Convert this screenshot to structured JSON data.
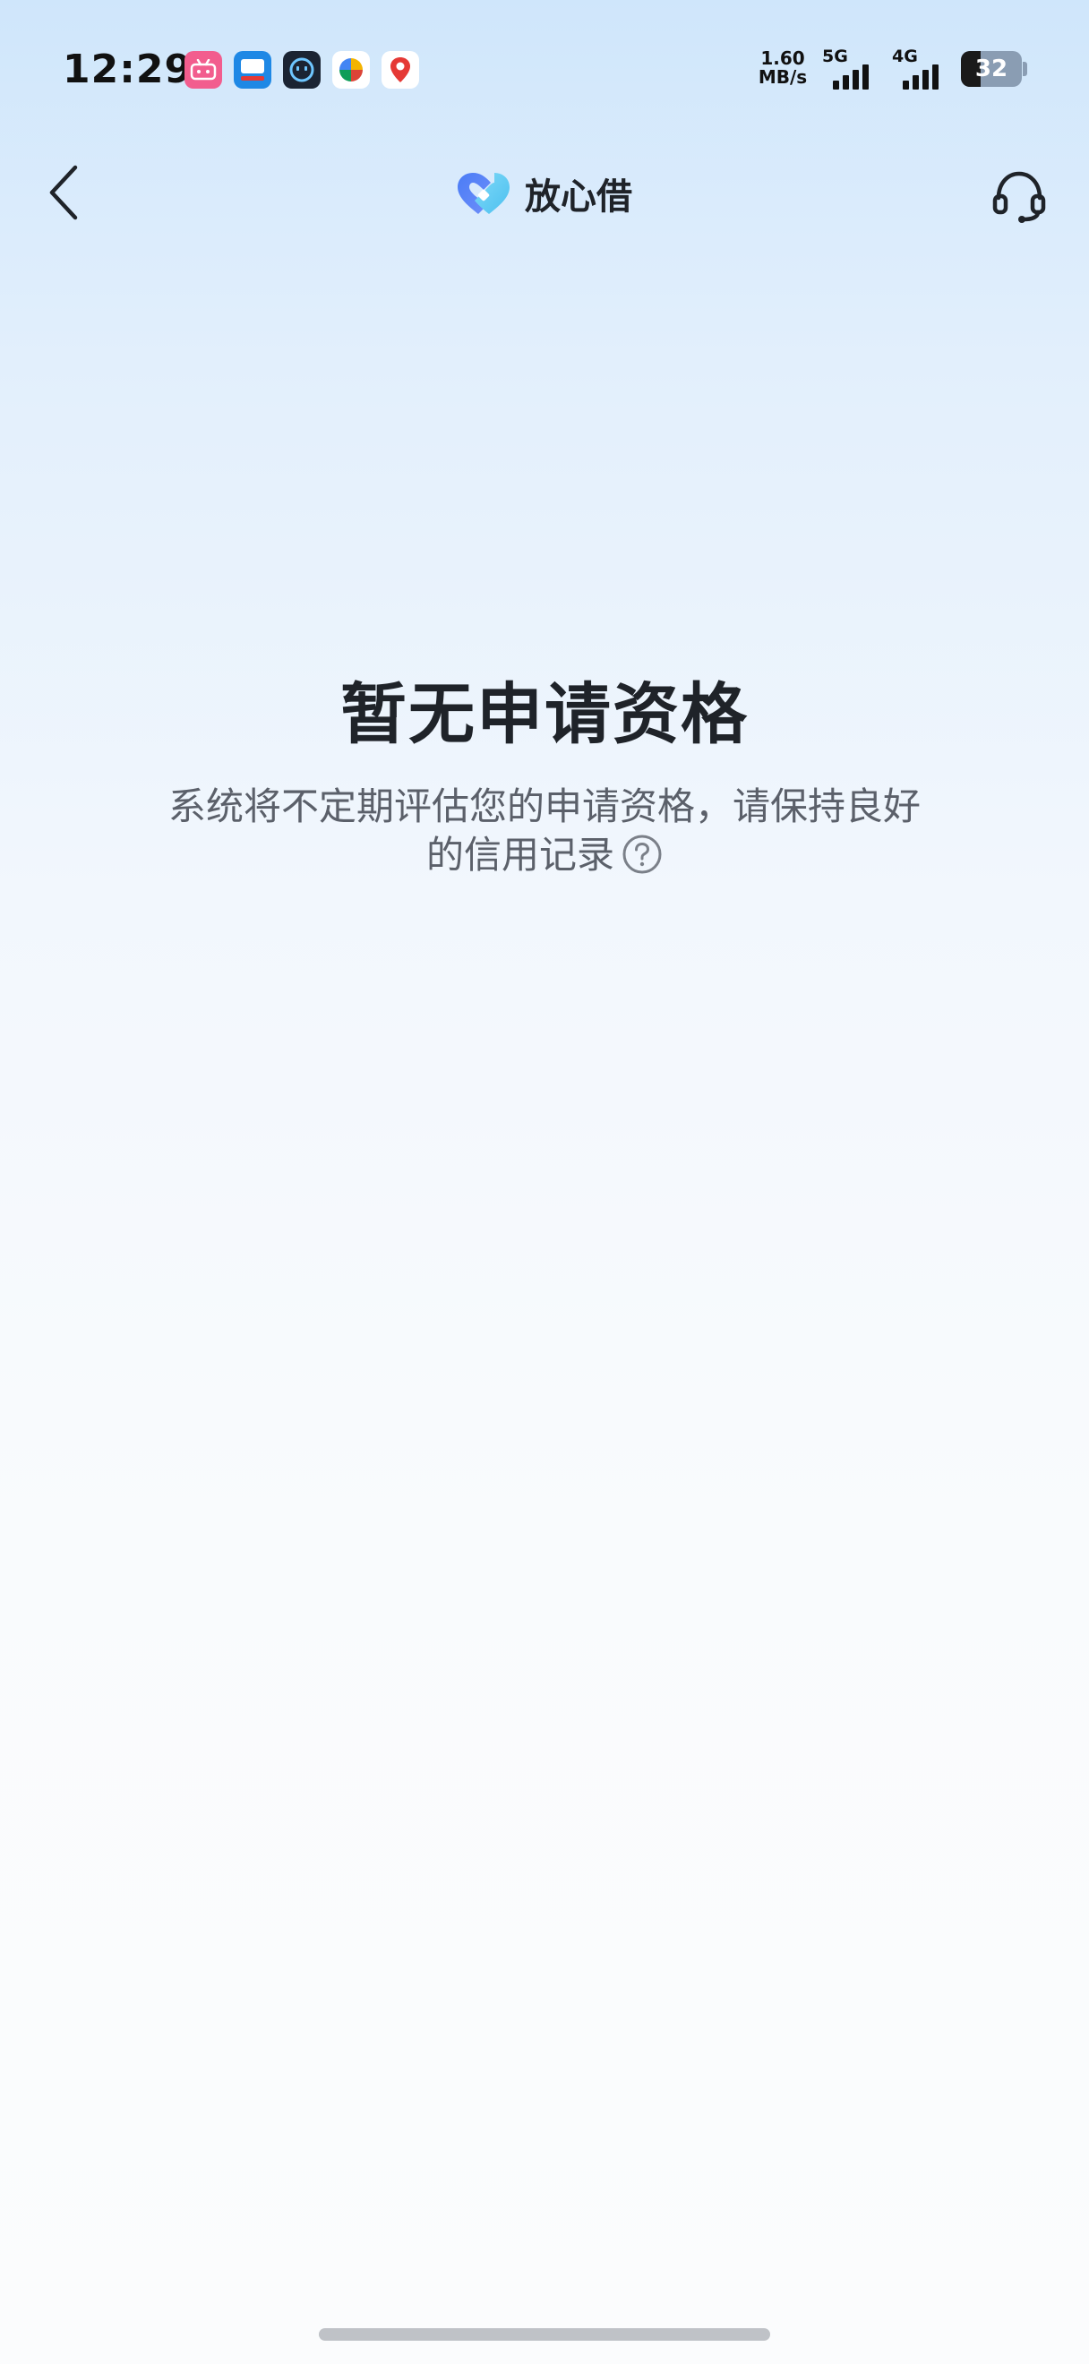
{
  "status_bar": {
    "time": "12:29",
    "net_speed_value": "1.60",
    "net_speed_unit": "MB/s",
    "signal_1_label": "5G",
    "signal_2_label": "4G",
    "battery_level": "32",
    "battery_fraction": 0.32,
    "notification_icons": [
      "bilibili-icon",
      "hello-icon",
      "robot-app-icon",
      "pinwheel-app-icon",
      "map-app-icon"
    ]
  },
  "header": {
    "brand_name": "放心借",
    "brand_colors": [
      "#4a7cf6",
      "#5ac8f5"
    ]
  },
  "main": {
    "title": "暂无申请资格",
    "description": "系统将不定期评估您的申请资格，请保持良好的信用记录"
  },
  "colors": {
    "title_text": "#1f2329",
    "description_text": "#5b606a",
    "background_top": "#cfe6fb",
    "background_bottom": "#fbfcfd"
  }
}
